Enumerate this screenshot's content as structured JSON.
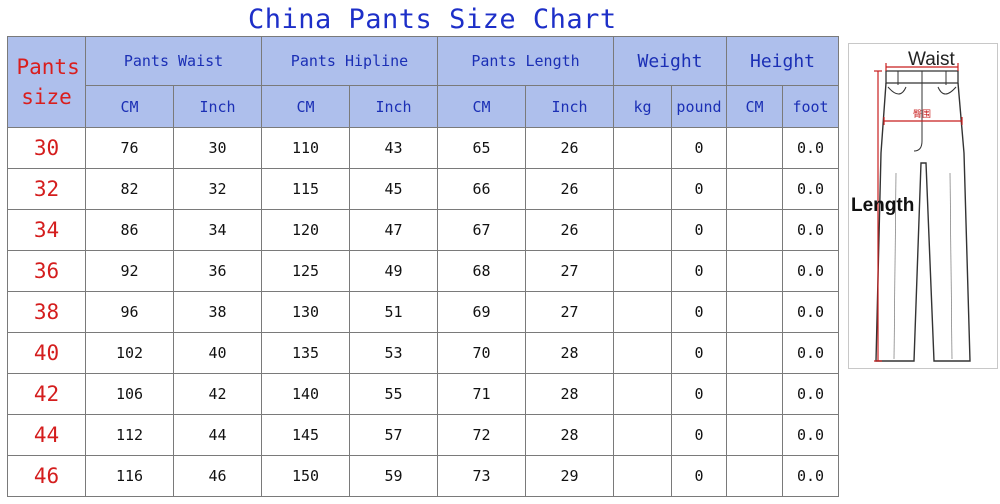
{
  "title": "China Pants Size Chart",
  "headers": {
    "size": "Pants size",
    "groups": [
      "Pants Waist",
      "Pants Hipline",
      "Pants Length",
      "Weight",
      "Height"
    ],
    "units": [
      "CM",
      "Inch",
      "CM",
      "Inch",
      "CM",
      "Inch",
      "kg",
      "pound",
      "CM",
      "foot"
    ]
  },
  "rows": [
    {
      "size": "30",
      "cells": [
        "76",
        "30",
        "110",
        "43",
        "65",
        "26",
        "",
        "0",
        "",
        "0.0"
      ]
    },
    {
      "size": "32",
      "cells": [
        "82",
        "32",
        "115",
        "45",
        "66",
        "26",
        "",
        "0",
        "",
        "0.0"
      ]
    },
    {
      "size": "34",
      "cells": [
        "86",
        "34",
        "120",
        "47",
        "67",
        "26",
        "",
        "0",
        "",
        "0.0"
      ]
    },
    {
      "size": "36",
      "cells": [
        "92",
        "36",
        "125",
        "49",
        "68",
        "27",
        "",
        "0",
        "",
        "0.0"
      ]
    },
    {
      "size": "38",
      "cells": [
        "96",
        "38",
        "130",
        "51",
        "69",
        "27",
        "",
        "0",
        "",
        "0.0"
      ]
    },
    {
      "size": "40",
      "cells": [
        "102",
        "40",
        "135",
        "53",
        "70",
        "28",
        "",
        "0",
        "",
        "0.0"
      ]
    },
    {
      "size": "42",
      "cells": [
        "106",
        "42",
        "140",
        "55",
        "71",
        "28",
        "",
        "0",
        "",
        "0.0"
      ]
    },
    {
      "size": "44",
      "cells": [
        "112",
        "44",
        "145",
        "57",
        "72",
        "28",
        "",
        "0",
        "",
        "0.0"
      ]
    },
    {
      "size": "46",
      "cells": [
        "116",
        "46",
        "150",
        "59",
        "73",
        "29",
        "",
        "0",
        "",
        "0.0"
      ]
    }
  ],
  "illustration": {
    "waist_label": "Waist",
    "length_label": "Length",
    "hip_label": "臀围"
  },
  "colors": {
    "header_bg": "#aebfec",
    "header_text": "#1b2fb5",
    "size_text": "#d41d1d",
    "title_text": "#1d2fc8",
    "measure_line": "#c81e1e"
  }
}
